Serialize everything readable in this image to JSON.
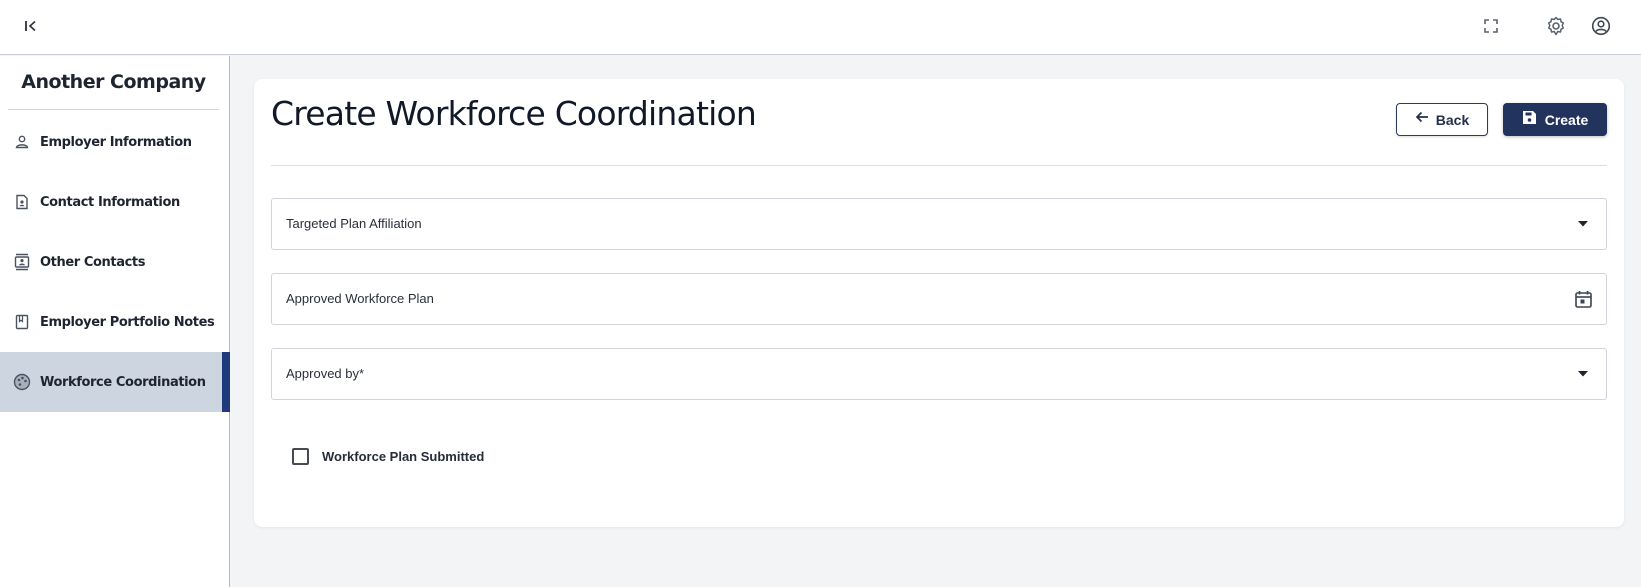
{
  "sidebar": {
    "company_name": "Another Company",
    "items": [
      {
        "label": "Employer Information",
        "icon": "person-icon"
      },
      {
        "label": "Contact Information",
        "icon": "contact-card-icon"
      },
      {
        "label": "Other Contacts",
        "icon": "contacts-book-icon"
      },
      {
        "label": "Employer Portfolio Notes",
        "icon": "notes-icon"
      },
      {
        "label": "Workforce Coordination",
        "icon": "palette-icon",
        "active": true
      }
    ]
  },
  "header": {
    "icons": [
      "collapse-sidebar-icon",
      "fullscreen-icon",
      "gear-icon",
      "user-account-icon"
    ]
  },
  "main": {
    "title": "Create Workforce Coordination",
    "back_label": "Back",
    "create_label": "Create",
    "fields": [
      {
        "label": "Targeted Plan Affiliation",
        "type": "select"
      },
      {
        "label": "Approved Workforce Plan",
        "type": "date"
      },
      {
        "label": "Approved by",
        "required_mark": "*",
        "type": "select"
      }
    ],
    "checkbox_label": "Workforce Plan Submitted",
    "checkbox_checked": false
  },
  "colors": {
    "primary": "#22345e",
    "active_nav_bg": "#cdd5e0",
    "active_nav_bar": "#1f3a7a",
    "page_bg": "#f3f4f6"
  }
}
